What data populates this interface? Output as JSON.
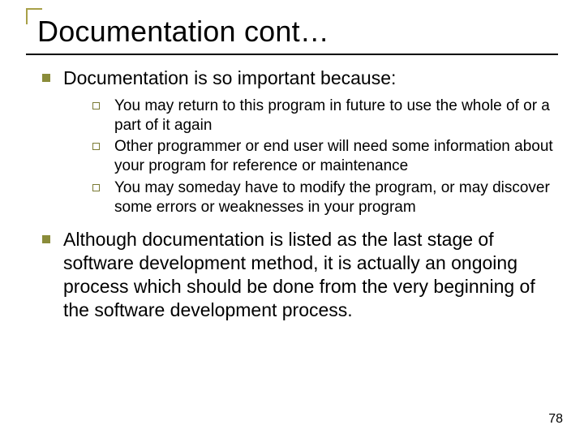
{
  "slide": {
    "title": "Documentation cont…",
    "points": [
      {
        "text": "Documentation is so important because:",
        "sub": [
          "You may return to this program in future to use the whole of or a part of it again",
          "Other programmer or end user will need some information about your program for reference or maintenance",
          "You may someday have to modify the program, or may discover some errors or weaknesses in your program"
        ]
      },
      {
        "text": "Although documentation is listed as the last stage of software development method, it is actually an ongoing process which should be done from the very beginning of the software development process.",
        "sub": []
      }
    ],
    "page_number": "78"
  },
  "colors": {
    "accent": "#a8a048",
    "bullet": "#8a8c3a"
  }
}
